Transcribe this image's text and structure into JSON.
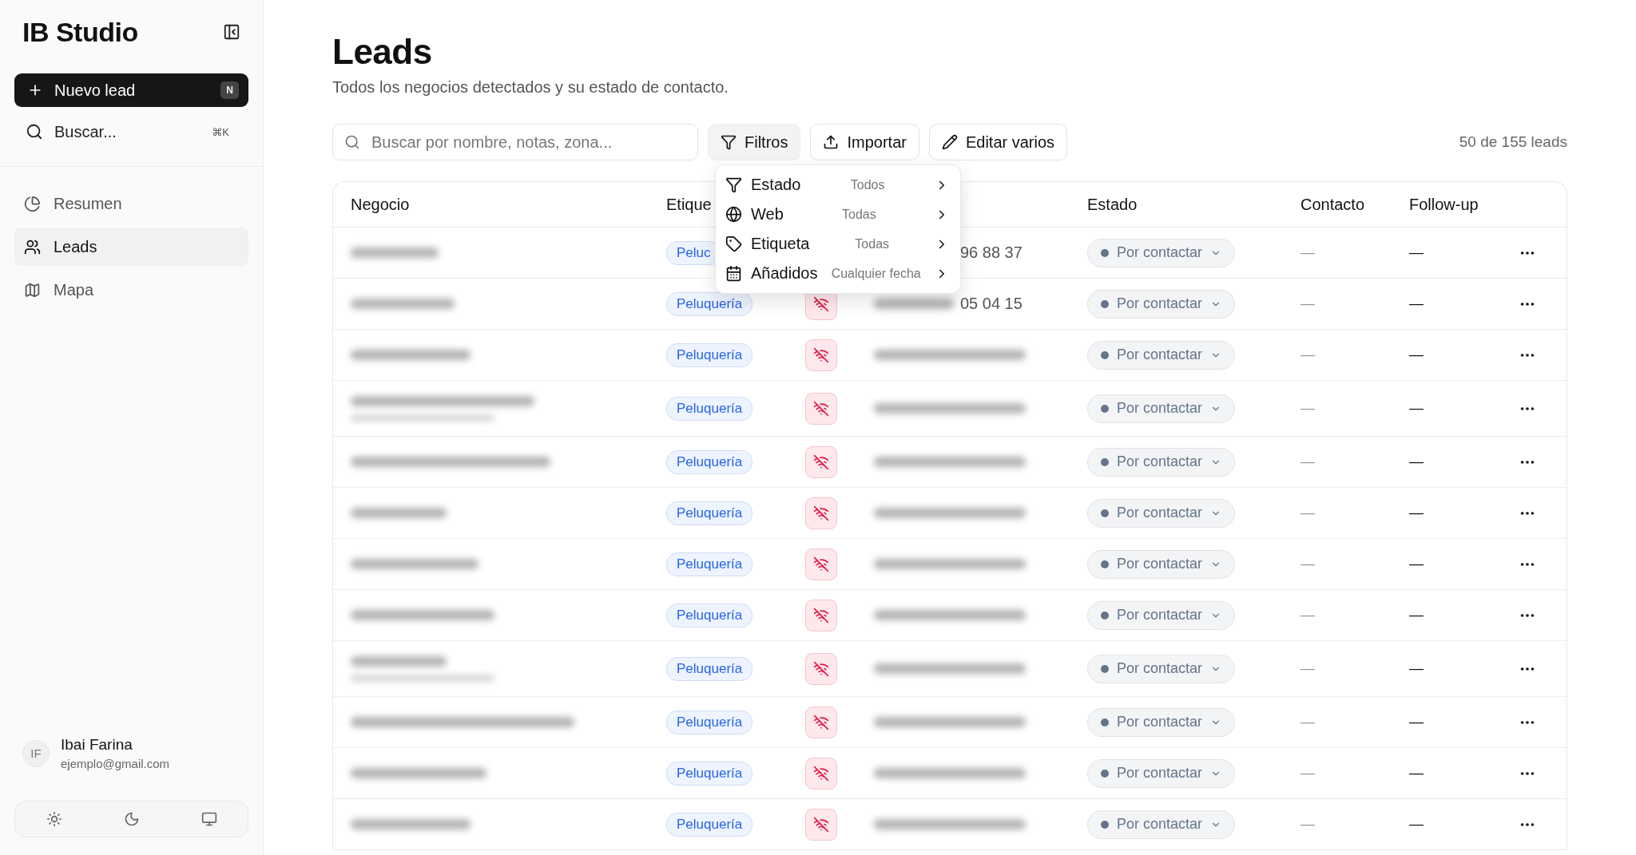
{
  "sidebar": {
    "brand": "IB Studio",
    "new_button": {
      "label": "Nuevo lead",
      "shortcut": "N"
    },
    "search": {
      "label": "Buscar...",
      "shortcut": "⌘K"
    },
    "items": [
      {
        "label": "Resumen",
        "selected": false
      },
      {
        "label": "Leads",
        "selected": true
      },
      {
        "label": "Mapa",
        "selected": false
      }
    ],
    "user": {
      "initials": "IF",
      "name": "Ibai Farina",
      "email": "ejemplo@gmail.com"
    }
  },
  "page": {
    "title": "Leads",
    "subtitle": "Todos los negocios detectados y su estado de contacto."
  },
  "toolbar": {
    "search": {
      "placeholder": "Buscar por nombre, notas, zona..."
    },
    "filters": {
      "label": "Filtros",
      "open": true
    },
    "import": {
      "label": "Importar"
    },
    "bulk_edit": {
      "label": "Editar varios"
    },
    "count": "50 de 155 leads"
  },
  "filter_menu": [
    {
      "label": "Estado",
      "value": "Todos"
    },
    {
      "label": "Web",
      "value": "Todas"
    },
    {
      "label": "Etiqueta",
      "value": "Todas"
    },
    {
      "label": "Añadidos",
      "value": "Cualquier fecha"
    }
  ],
  "table": {
    "columns": [
      "Negocio",
      "Etique",
      "Estado",
      "Contacto",
      "Follow-up"
    ],
    "rows": [
      {
        "subtitle": false,
        "tag": "Peluc",
        "phone": "96 88 37",
        "status": "Por contactar",
        "contact": "—",
        "followup": "—"
      },
      {
        "subtitle": false,
        "tag": "Peluquería",
        "phone": "05 04 15",
        "status": "Por contactar",
        "contact": "—",
        "followup": "—"
      },
      {
        "subtitle": false,
        "tag": "Peluquería",
        "status": "Por contactar",
        "contact": "—",
        "followup": "—"
      },
      {
        "subtitle": true,
        "tag": "Peluquería",
        "status": "Por contactar",
        "contact": "—",
        "followup": "—"
      },
      {
        "subtitle": false,
        "tag": "Peluquería",
        "status": "Por contactar",
        "contact": "—",
        "followup": "—"
      },
      {
        "subtitle": false,
        "tag": "Peluquería",
        "status": "Por contactar",
        "contact": "—",
        "followup": "—"
      },
      {
        "subtitle": false,
        "tag": "Peluquería",
        "status": "Por contactar",
        "contact": "—",
        "followup": "—"
      },
      {
        "subtitle": false,
        "tag": "Peluquería",
        "status": "Por contactar",
        "contact": "—",
        "followup": "—"
      },
      {
        "subtitle": true,
        "tag": "Peluquería",
        "status": "Por contactar",
        "contact": "—",
        "followup": "—"
      },
      {
        "subtitle": false,
        "tag": "Peluquería",
        "status": "Por contactar",
        "contact": "—",
        "followup": "—"
      },
      {
        "subtitle": false,
        "tag": "Peluquería",
        "status": "Por contactar",
        "contact": "—",
        "followup": "—"
      },
      {
        "subtitle": false,
        "tag": "Peluquería",
        "status": "Por contactar",
        "contact": "—",
        "followup": "—"
      }
    ]
  }
}
